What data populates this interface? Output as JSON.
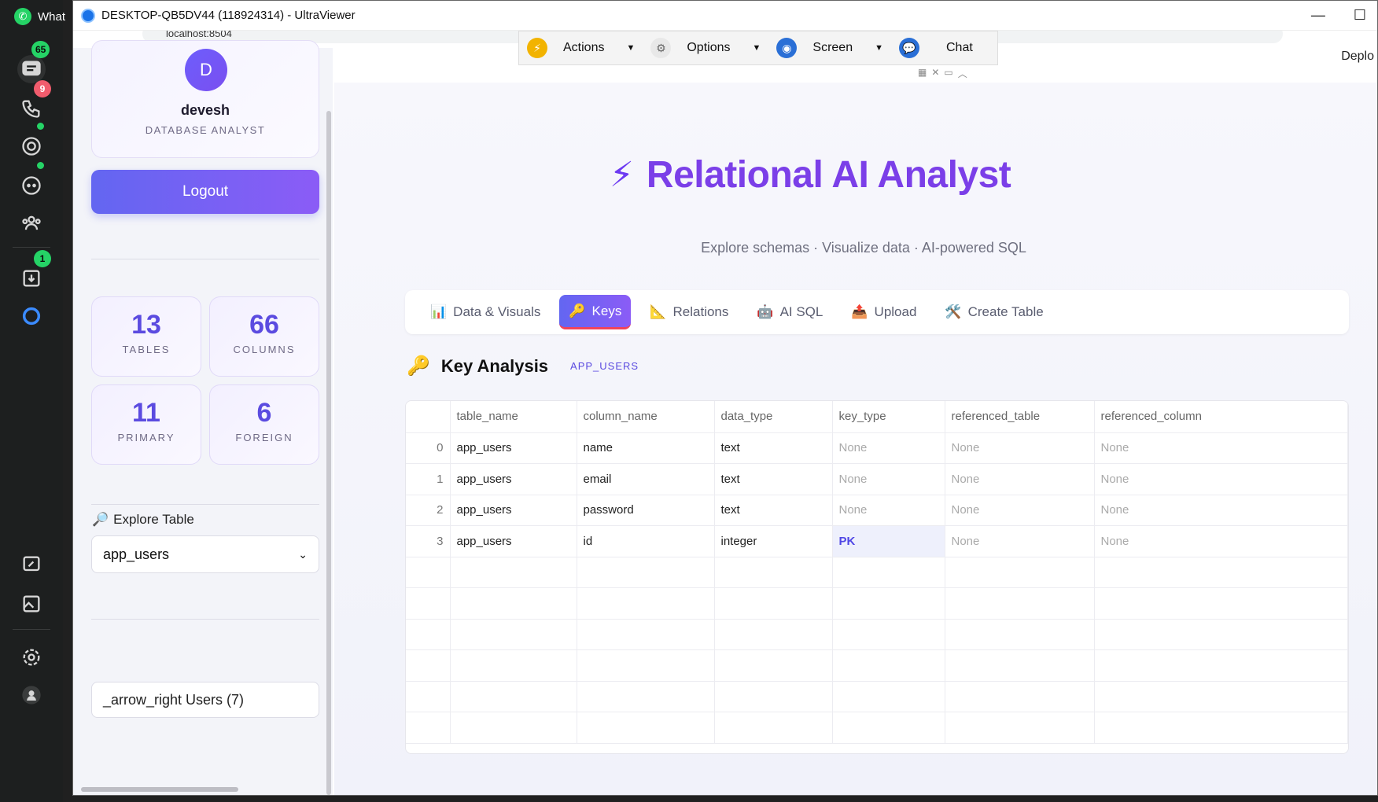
{
  "whatsapp": {
    "title": "What",
    "badges": {
      "chats": "65",
      "calls": "9",
      "downloads": "1"
    }
  },
  "uv": {
    "title": "DESKTOP-QB5DV44 (118924314) - UltraViewer",
    "toolbar": {
      "actions": "Actions",
      "options": "Options",
      "screen": "Screen",
      "chat": "Chat"
    }
  },
  "browser": {
    "url": "localhost:8504",
    "deploy": "Deplo"
  },
  "sidebar": {
    "avatar_letter": "D",
    "user_name": "devesh",
    "user_role": "DATABASE ANALYST",
    "logout": "Logout",
    "stats": [
      {
        "num": "13",
        "label": "TABLES"
      },
      {
        "num": "66",
        "label": "COLUMNS"
      },
      {
        "num": "11",
        "label": "PRIMARY"
      },
      {
        "num": "6",
        "label": "FOREIGN"
      }
    ],
    "explore_label": "Explore Table",
    "selected_table": "app_users",
    "expander_label": "_arrow_right Users (7)"
  },
  "main": {
    "title": "Relational AI Analyst",
    "subtitle": "Explore schemas · Visualize data · AI-powered SQL",
    "tabs": [
      {
        "icon": "📊",
        "label": "Data & Visuals"
      },
      {
        "icon": "🔑",
        "label": "Keys"
      },
      {
        "icon": "📐",
        "label": "Relations"
      },
      {
        "icon": "🤖",
        "label": "AI SQL"
      },
      {
        "icon": "📤",
        "label": "Upload"
      },
      {
        "icon": "🛠️",
        "label": "Create Table"
      }
    ],
    "section_title": "Key Analysis",
    "section_tag": "APP_USERS",
    "table": {
      "columns": [
        "",
        "table_name",
        "column_name",
        "data_type",
        "key_type",
        "referenced_table",
        "referenced_column"
      ],
      "rows": [
        [
          "0",
          "app_users",
          "name",
          "text",
          "None",
          "None",
          "None"
        ],
        [
          "1",
          "app_users",
          "email",
          "text",
          "None",
          "None",
          "None"
        ],
        [
          "2",
          "app_users",
          "password",
          "text",
          "None",
          "None",
          "None"
        ],
        [
          "3",
          "app_users",
          "id",
          "integer",
          "PK",
          "None",
          "None"
        ]
      ]
    }
  },
  "colors": {
    "accent": "#6366f1",
    "accent2": "#8b5cf6",
    "title": "#7b3fe8",
    "tab_underline": "#f0445c"
  }
}
